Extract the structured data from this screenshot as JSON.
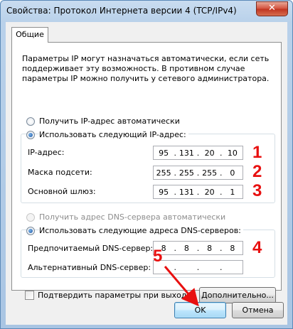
{
  "window": {
    "title": "Свойства: Протокол Интернета версии 4 (TCP/IPv4)",
    "close_glyph": "✕"
  },
  "tab": {
    "label": "Общие"
  },
  "description": "Параметры IP могут назначаться автоматически, если сеть поддерживает эту возможность. В противном случае параметры IP можно получить у сетевого администратора.",
  "ip_mode": {
    "auto_label": "Получить IP-адрес автоматически",
    "manual_label": "Использовать следующий IP-адрес:",
    "selected": "manual"
  },
  "ip_fields": [
    {
      "label": "IP-адрес:",
      "octets": [
        "95",
        "131",
        "20",
        "10"
      ],
      "annotation": "1"
    },
    {
      "label": "Маска подсети:",
      "octets": [
        "255",
        "255",
        "255",
        "0"
      ],
      "annotation": "2"
    },
    {
      "label": "Основной шлюз:",
      "octets": [
        "95",
        "131",
        "20",
        "1"
      ],
      "annotation": "3"
    }
  ],
  "dns_mode": {
    "auto_label": "Получить адрес DNS-сервера автоматически",
    "manual_label": "Использовать следующие адреса DNS-серверов:",
    "selected": "manual",
    "auto_disabled": true
  },
  "dns_fields": [
    {
      "label": "Предпочитаемый DNS-сервер:",
      "octets": [
        "8",
        "8",
        "8",
        "8"
      ],
      "annotation": "4"
    },
    {
      "label": "Альтернативный DNS-сервер:",
      "octets": [
        "",
        "",
        "",
        ""
      ]
    }
  ],
  "validate": {
    "label": "Подтвердить параметры при выходе",
    "checked": false
  },
  "buttons": {
    "advanced": "Дополнительно...",
    "ok": "OK",
    "cancel": "Отмена"
  },
  "annotations": {
    "ok_step": "5",
    "color": "#e81010"
  }
}
